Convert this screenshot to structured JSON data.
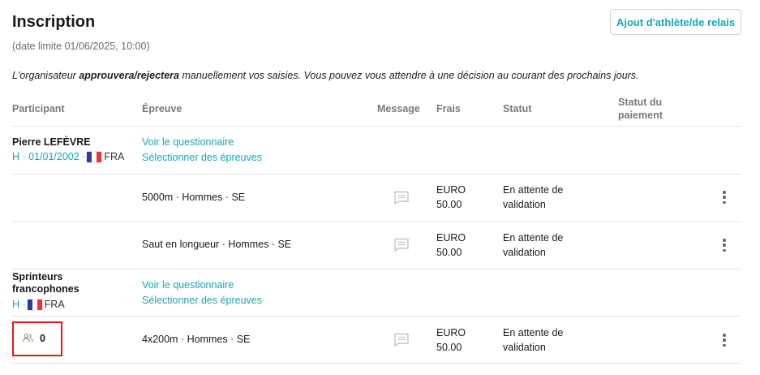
{
  "header": {
    "title": "Inscription",
    "deadline": "(date limite 01/06/2025, 10:00)",
    "add_button": "Ajout d'athlète/de relais"
  },
  "notice": {
    "prefix": "L'organisateur ",
    "bold": "approuvera/rejectera",
    "suffix": " manuellement vos saisies. Vous pouvez vous attendre à une décision au courant des prochains jours."
  },
  "columns": {
    "participant": "Participant",
    "event": "Épreuve",
    "message": "Message",
    "fee": "Frais",
    "status": "Statut",
    "payment_status_line1": "Statut du",
    "payment_status_line2": "paiement"
  },
  "participants": [
    {
      "name": "Pierre LEFÈVRE",
      "meta": "H · 01/01/2002 ·",
      "country": "FRA",
      "link_questionnaire": "Voir le questionnaire",
      "link_select_events": "Sélectionner des épreuves",
      "entries": [
        {
          "event": "5000m · Hommes · SE",
          "fee_currency": "EURO",
          "fee_amount": "50.00",
          "status_line1": "En attente de",
          "status_line2": "validation"
        },
        {
          "event": "Saut en longueur · Hommes · SE",
          "fee_currency": "EURO",
          "fee_amount": "50.00",
          "status_line1": "En attente de",
          "status_line2": "validation"
        }
      ]
    },
    {
      "name_line1": "Sprinteurs",
      "name_line2": "francophones",
      "meta": "H ·",
      "country": "FRA",
      "link_questionnaire": "Voir le questionnaire",
      "link_select_events": "Sélectionner des épreuves",
      "members_count": "0",
      "entries": [
        {
          "event": "4x200m · Hommes · SE",
          "fee_currency": "EURO",
          "fee_amount": "50.00",
          "status_line1": "En attente de",
          "status_line2": "validation"
        }
      ]
    }
  ],
  "icons": {
    "message": "message-icon",
    "more": "more-vert-icon",
    "members": "group-icon",
    "flag": "flag-fr-icon"
  },
  "colors": {
    "accent": "#1aa5b8",
    "highlight": "#e11b1b",
    "flag_blue": "#2b3e9c",
    "flag_white": "#ffffff",
    "flag_red": "#e8343a"
  }
}
